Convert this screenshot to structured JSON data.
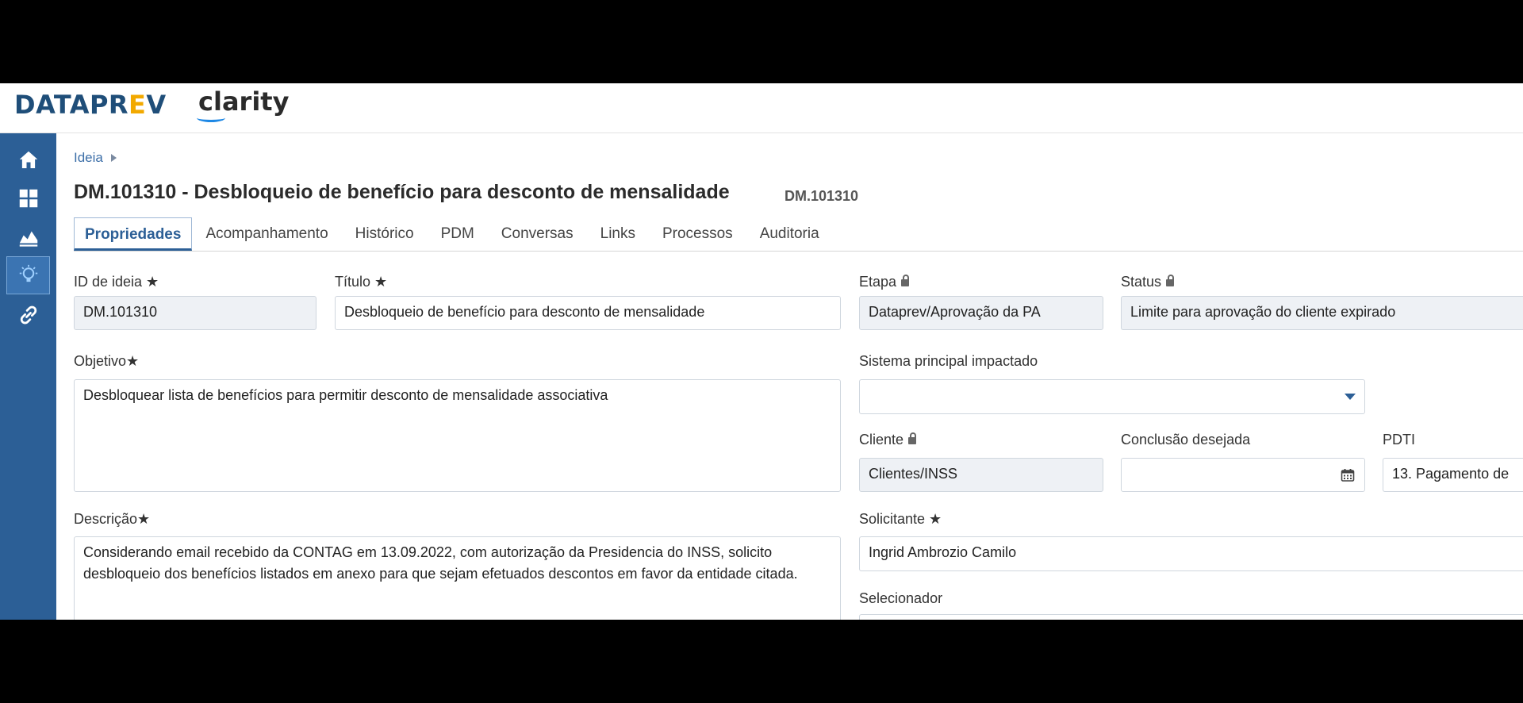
{
  "header": {
    "brand_prefix": "DATAPR",
    "brand_accent": "E",
    "brand_suffix": "V",
    "product": "clarity"
  },
  "sidebar": {
    "items": [
      {
        "icon": "home-icon"
      },
      {
        "icon": "dashboard-icon"
      },
      {
        "icon": "chart-icon"
      },
      {
        "icon": "lightbulb-icon",
        "active": true
      },
      {
        "icon": "link-icon"
      }
    ]
  },
  "breadcrumb": {
    "label": "Ideia"
  },
  "page": {
    "title": "DM.101310 - Desbloqueio de benefício para desconto de mensalidade",
    "id": "DM.101310"
  },
  "tabs": [
    "Propriedades",
    "Acompanhamento",
    "Histórico",
    "PDM",
    "Conversas",
    "Links",
    "Processos",
    "Auditoria"
  ],
  "form": {
    "id_label": "ID de ideia ★",
    "id_value": "DM.101310",
    "titulo_label": "Título ★",
    "titulo_value": "Desbloqueio de benefício para desconto de mensalidade",
    "etapa_label": "Etapa",
    "etapa_value": "Dataprev/Aprovação da PA",
    "status_label": "Status",
    "status_value": "Limite para aprovação do cliente expirado",
    "objetivo_label": "Objetivo★",
    "objetivo_value": "Desbloquear lista de benefícios para permitir desconto de mensalidade associativa",
    "sistema_label": "Sistema principal impactado",
    "sistema_value": "",
    "cliente_label": "Cliente",
    "cliente_value": "Clientes/INSS",
    "conclusao_label": "Conclusão desejada",
    "conclusao_value": "",
    "pdti_label": "PDTI",
    "pdti_value": "13. Pagamento de",
    "descricao_label": "Descrição★",
    "descricao_value": "Considerando email recebido da CONTAG em 13.09.2022, com autorização da Presidencia do INSS, solicito desbloqueio dos benefícios listados em anexo para que sejam efetuados descontos em favor da entidade citada.",
    "solicitante_label": "Solicitante ★",
    "solicitante_value": "Ingrid Ambrozio Camilo",
    "selecionador_label": "Selecionador"
  },
  "colors": {
    "sidebar": "#2c5f96",
    "brand": "#1f4e79",
    "accent": "#f2a900",
    "link": "#3d6fa8"
  }
}
